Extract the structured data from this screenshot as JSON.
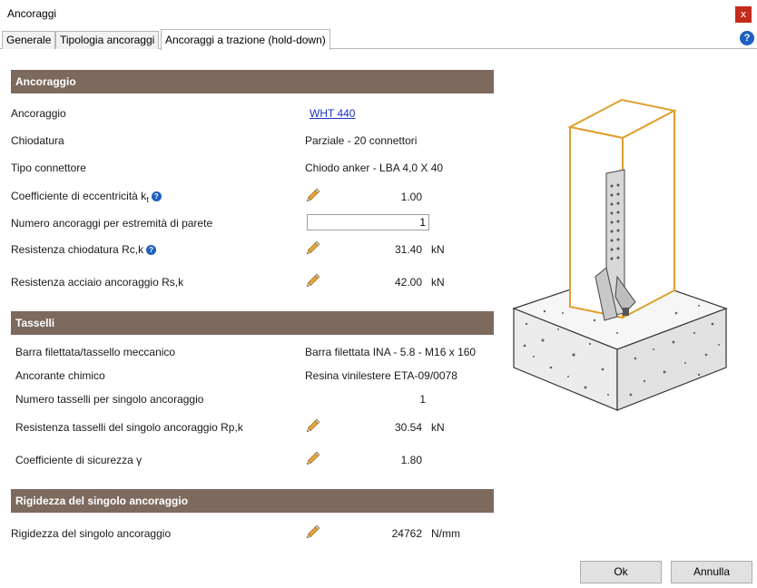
{
  "window": {
    "title": "Ancoraggi",
    "close_glyph": "x"
  },
  "tabs": [
    {
      "label": "Generale",
      "active": false
    },
    {
      "label": "Tipologia ancoraggi",
      "active": false
    },
    {
      "label": "Ancoraggi a trazione (hold-down)",
      "active": true
    }
  ],
  "help_icon": "question-circle-icon",
  "sections": {
    "ancoraggio": {
      "title": "Ancoraggio",
      "rows": {
        "ancoraggio": {
          "label": "Ancoraggio",
          "value": "WHT 440"
        },
        "chiodatura": {
          "label": "Chiodatura",
          "value": "Parziale - 20 connettori"
        },
        "tipo_connettore": {
          "label": "Tipo connettore",
          "value": "Chiodo anker - LBA 4,0 X 40"
        },
        "eccentricita": {
          "label": "Coefficiente di eccentricità  k",
          "label_sub": "t",
          "value": "1.00"
        },
        "numero_ancoraggi": {
          "label": "Numero ancoraggi per estremità di parete",
          "value": "1"
        },
        "resistenza_chiodatura": {
          "label": "Resistenza chiodatura Rc,k",
          "value": "31.40",
          "unit": "kN"
        },
        "resistenza_acciaio": {
          "label": "Resistenza acciaio ancoraggio Rs,k",
          "value": "42.00",
          "unit": "kN"
        }
      }
    },
    "tasselli": {
      "title": "Tasselli",
      "rows": {
        "barra": {
          "label": "Barra filettata/tassello meccanico",
          "value": "Barra filettata INA - 5.8 - M16 x 160"
        },
        "ancorante": {
          "label": "Ancorante chimico",
          "value": "Resina vinilestere ETA-09/0078"
        },
        "numero_tasselli": {
          "label": "Numero tasselli per singolo ancoraggio",
          "value": "1"
        },
        "resistenza_tasselli": {
          "label": "Resistenza tasselli del singolo ancoraggio Rp,k",
          "value": "30.54",
          "unit": "kN"
        },
        "sicurezza": {
          "label": "Coefficiente di sicurezza γ",
          "value": "1.80"
        }
      }
    },
    "rigidezza": {
      "title": "Rigidezza del singolo ancoraggio",
      "rows": {
        "rigidezza": {
          "label": "Rigidezza del singolo ancoraggio",
          "value": "24762",
          "unit": "N/mm"
        }
      }
    }
  },
  "buttons": {
    "ok": "Ok",
    "cancel": "Annulla"
  },
  "info_glyph": "?",
  "icons": {
    "edit": "pencil-icon",
    "info": "info-circle-icon"
  },
  "colors": {
    "section_header": "#7d6a5f",
    "link": "#1a35c4",
    "wall_outline": "#e0a030",
    "close_button": "#c42b1c",
    "help": "#1f5fbf"
  }
}
